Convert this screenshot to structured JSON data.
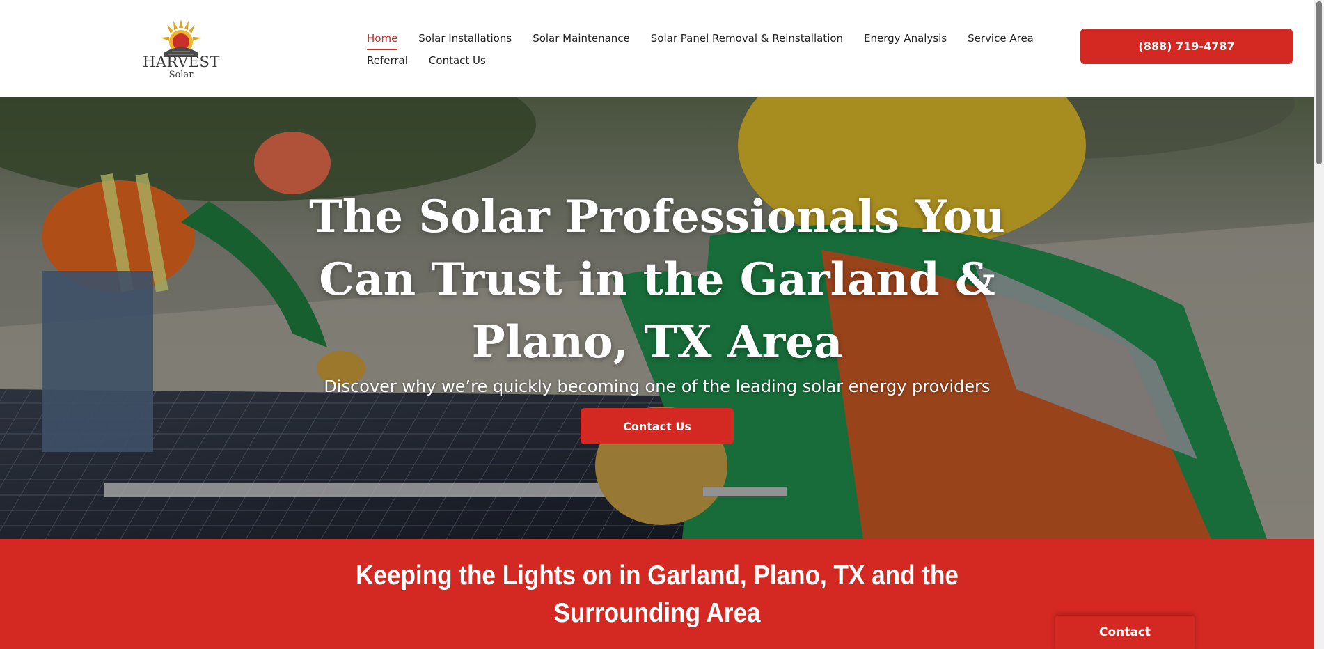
{
  "brand": {
    "logo_word": "HARVEST",
    "logo_sub": "Solar",
    "accent_color": "#d42823"
  },
  "nav": {
    "items": [
      {
        "label": "Home",
        "active": true
      },
      {
        "label": "Solar Installations",
        "active": false
      },
      {
        "label": "Solar Maintenance",
        "active": false
      },
      {
        "label": "Solar Panel Removal & Reinstallation",
        "active": false
      },
      {
        "label": "Energy Analysis",
        "active": false
      },
      {
        "label": "Service Area",
        "active": false
      },
      {
        "label": "Referral",
        "active": false
      },
      {
        "label": "Contact Us",
        "active": false
      }
    ],
    "phone_label": "(888) 719-4787"
  },
  "hero": {
    "title": "The Solar Professionals You Can Trust in the Garland & Plano, TX Area",
    "subtitle": "Discover why we’re quickly becoming one of the leading solar energy providers",
    "cta_label": "Contact Us"
  },
  "band": {
    "title": "Keeping the Lights on in Garland, Plano, TX and the Surrounding Area"
  },
  "floating": {
    "contact_label": "Contact"
  }
}
